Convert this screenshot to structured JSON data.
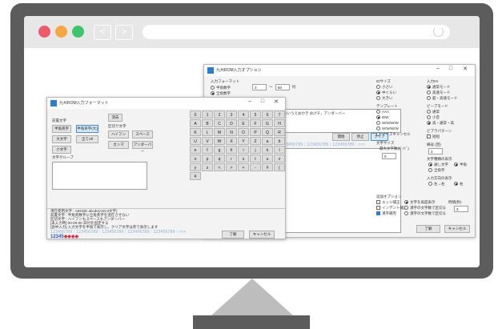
{
  "colors": {
    "bezel": "#5c5c5c",
    "toolbar": "#e7e7e7",
    "traffic_red": "#ee5a6a",
    "traffic_orange": "#f4a742",
    "traffic_green": "#3fc46e",
    "accent": "#2c7cd6",
    "stand_neck": "#bdbdbd"
  },
  "browser": {
    "back_icon": "chevron-left-icon",
    "back_glyph": "<",
    "forward_icon": "chevron-right-icon",
    "forward_glyph": ">",
    "reload_icon": "reload-icon"
  },
  "options_window": {
    "title": "九州ROM入力オプション",
    "controls": {
      "minimize": "–",
      "maximize": "□",
      "close": "✕"
    },
    "section_input_length": "入力フォーマット",
    "radio_fixed": "半角数字",
    "radio_variable": "全角数字",
    "spin_min": "3",
    "range_sep": "〜",
    "spin_max": "50",
    "unit": "桁",
    "section_size": "IDサイズ",
    "size_small": "小さい",
    "size_medium": "中ぐらい",
    "size_large": "大きい",
    "section_input_mode": "入力Hz",
    "mode_a": "通常モード",
    "mode_b": "高速モード",
    "mode_c": "超・高速モード",
    "section_font": "テンプレート",
    "font_a": "AAA",
    "font_b": "B/W",
    "font_c": "W/W/W/W",
    "font_d": "W/W/W/W",
    "font_e": "ノイズキャンセル",
    "section_beep": "ビープモード",
    "beep_a": "通常",
    "beep_b": "小音",
    "beep_c": "高・通常・高",
    "section_pattern": "ビブラパターン",
    "pattern_a": "短短",
    "section_loop": "繰返 (回)",
    "loop_value": "3",
    "section_digit_size": "文字サイズ",
    "digit_size_label": "最大文字数(ｶﾞｲﾄﾞ)",
    "digit_size_value": "0",
    "section_char_block": "文字種類の表示",
    "char_a": "通し文字",
    "char_b": "半角",
    "char_c": "全角字",
    "section_input_dir": "入力方向の表示",
    "dir_a": "左→右",
    "dir_b": "右",
    "preview_text": "あいうえおかき  おけチ，アンダーバー",
    "btn_kaishi": "開始",
    "btn_teishi": "停止",
    "btn_clear": "クリア",
    "digits_row": "123456789｜123456789｜123456789｜<<<",
    "section_option": "追加オプション",
    "opt_a": "エッジ補正",
    "opt_b": "インデント補正",
    "opt_c": "漢字補完",
    "opt_d": "文字を再度表示",
    "opt_e": "漢字の文字数で区切る",
    "opt_f": "漢字の文字数で区切る",
    "opt_g": "時間(秒)",
    "opt_spin": "3",
    "btn_ok": "了解",
    "btn_cancel": "キャンセル"
  },
  "keyboard_window": {
    "title": "九州ROM入力フォーマット",
    "controls": {
      "minimize": "–",
      "maximize": "□",
      "close": "✕"
    },
    "section_input": "前置文字",
    "btn_hankaku": "半角英字",
    "btn_zenkaku": "半角英字(大)",
    "btn_kakko": "大文字",
    "btn_kigou": "全てAll",
    "btn_kanji": "小文字",
    "btn_erase": "消去",
    "section_char": "区切り文字",
    "btn_hyphen": "ハイフン",
    "btn_space": "スペース",
    "btn_comma": "カンマ",
    "btn_underbar": "アンダーバー",
    "section_custom": "文字グループ",
    "keys": [
      "0",
      "1",
      "2",
      "3",
      "4",
      "5",
      "6",
      "7",
      "8",
      "A",
      "B",
      "C",
      "D",
      "E",
      "F",
      "G",
      "H",
      "I",
      "K",
      "L",
      "M",
      "N",
      "O",
      "P",
      "Q",
      "R",
      "S",
      "U",
      "V",
      "W",
      "X",
      "Y",
      "Z",
      "a",
      "b",
      "c",
      "e",
      "f",
      "g",
      "h",
      "i",
      "j",
      "k",
      "l",
      "m",
      "o",
      "p",
      "q",
      "r",
      "s",
      "t",
      "u",
      "v",
      "w",
      "y",
      "z",
      "<",
      ">",
      "+",
      "-",
      "#",
      "(",
      ")",
      "¥"
    ],
    "info_line1": "現在使用文字 : ABCDE abcde(ASCII文字)",
    "info_line2": "前置文字 : 半角英数字に全角英字を混在させない",
    "info_line3": "区切文字 : ハイフンもスペースもアンダーバー",
    "info_line4": "[未入力時] 00-00-00 日付を固定する",
    "info_line5": "[途中入力] 入力文字を半角で表示し、クリア文字は赤で表示します",
    "digits_row": "123456789｜123456789｜123456789｜123456789｜123456789｜<<<",
    "entry_blue": "12345",
    "entry_red": "◆◆◆◆",
    "btn_ok": "了解",
    "btn_cancel": "キャンセル"
  }
}
